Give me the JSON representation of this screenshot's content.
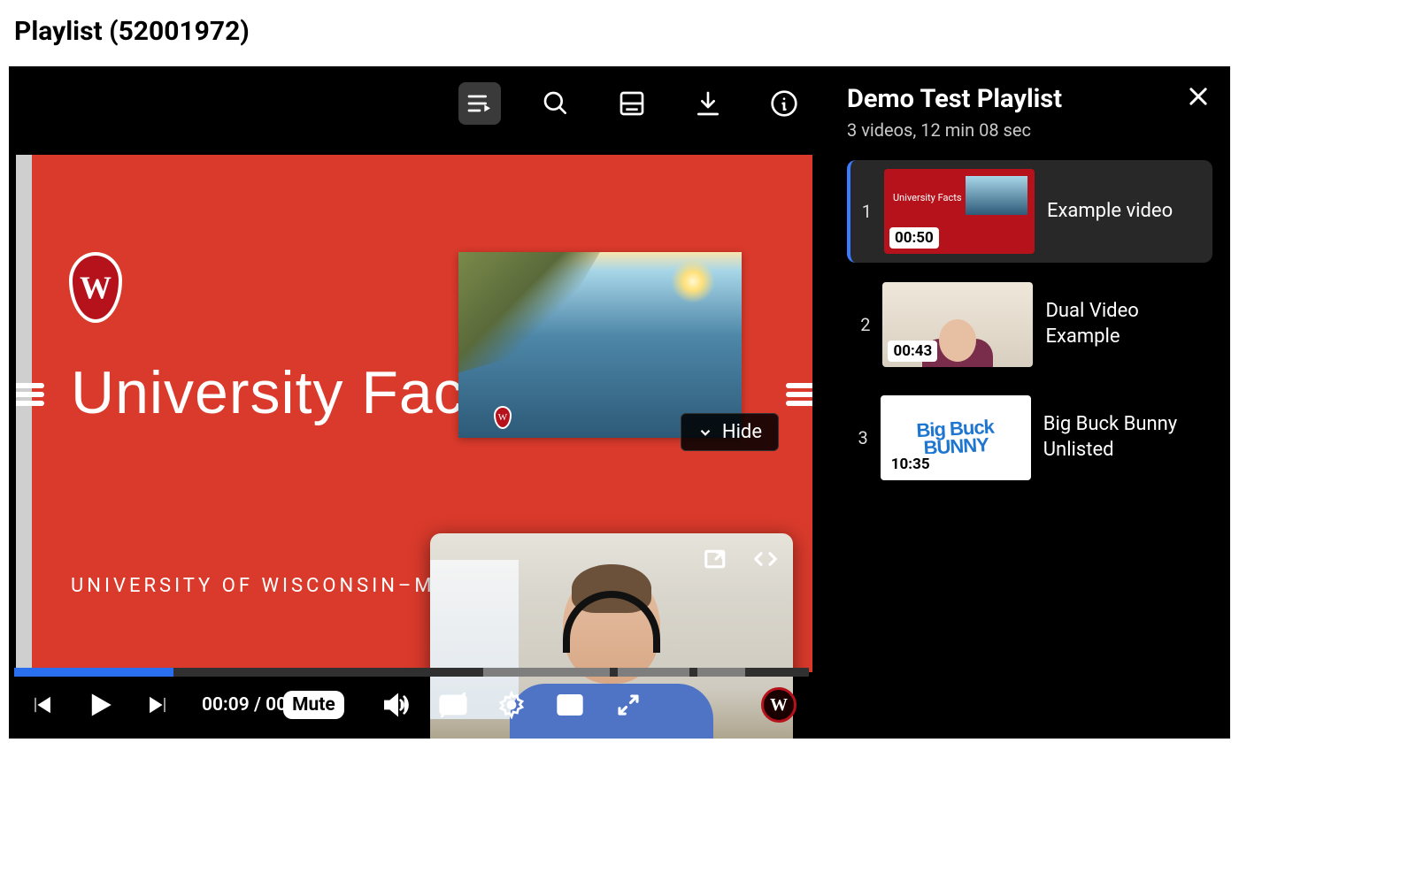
{
  "page_title": "Playlist (52001972)",
  "slide": {
    "title": "University Facts",
    "subtitle": "UNIVERSITY OF WISCONSIN–MAD",
    "hide_label": "Hide"
  },
  "controls": {
    "current_time": "00:09",
    "duration_prefix": "00",
    "mute_tooltip": "Mute",
    "progress_percent": 20
  },
  "playlist": {
    "title": "Demo Test Playlist",
    "summary": "3 videos, 12 min 08 sec",
    "items": [
      {
        "index": "1",
        "duration": "00:50",
        "title": "Example video"
      },
      {
        "index": "2",
        "duration": "00:43",
        "title": "Dual Video Example"
      },
      {
        "index": "3",
        "duration": "10:35",
        "title": "Big Buck Bunny Unlisted"
      }
    ]
  }
}
